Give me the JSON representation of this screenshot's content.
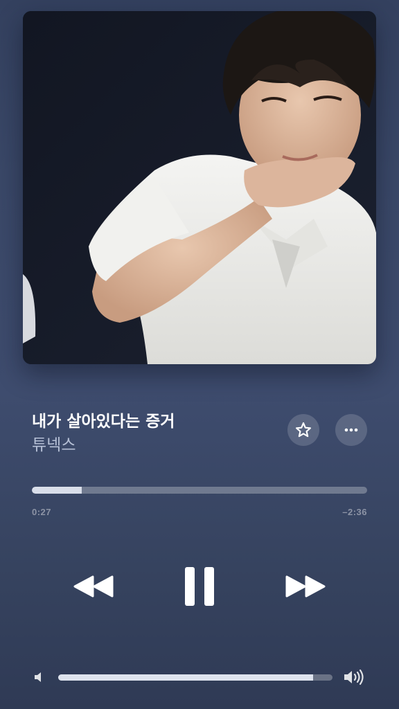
{
  "now_playing": {
    "title": "내가 살아있다는 증거",
    "artist": "튜넥스",
    "artwork_icon": "album-artwork"
  },
  "actions": {
    "favorite_icon": "star-icon",
    "more_icon": "ellipsis-icon"
  },
  "progress": {
    "elapsed": "0:27",
    "remaining": "–2:36",
    "fraction": 0.148
  },
  "controls": {
    "rewind_icon": "rewind-icon",
    "pause_icon": "pause-icon",
    "forward_icon": "fast-forward-icon"
  },
  "volume": {
    "level": 0.93,
    "low_icon": "speaker-low-icon",
    "high_icon": "speaker-high-icon"
  },
  "colors": {
    "background": "#3a4868",
    "text_primary": "#ffffff",
    "text_secondary": "#b6c0d6"
  }
}
